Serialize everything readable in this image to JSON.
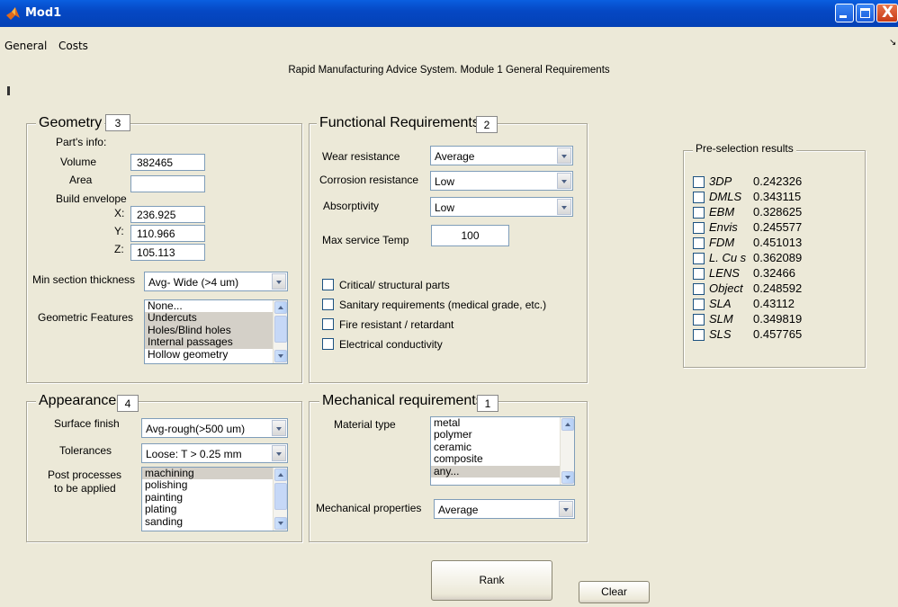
{
  "window": {
    "title": "Mod1",
    "close_label": "X"
  },
  "menu": [
    "General",
    "Costs"
  ],
  "header": "Rapid Manufacturing Advice System. Module 1 General Requirements",
  "geometry": {
    "title": "Geometry",
    "rank": "3",
    "parts_info": "Part's info:",
    "volume_label": "Volume",
    "volume_value": "382465",
    "area_label": "Area",
    "area_value": "",
    "build_envelope": "Build envelope",
    "x_label": "X:",
    "x_value": "236.925",
    "y_label": "Y:",
    "y_value": "110.966",
    "z_label": "Z:",
    "z_value": "105.113",
    "min_section_label": "Min section thickness",
    "min_section_value": "Avg- Wide (>4 um)",
    "features_label": "Geometric Features",
    "features": [
      "None...",
      "Undercuts",
      "Holes/Blind holes",
      "Internal passages",
      "Hollow geometry"
    ]
  },
  "functional": {
    "title": "Functional Requirements",
    "rank": "2",
    "wear_label": "Wear resistance",
    "wear_value": "Average",
    "corrosion_label": "Corrosion resistance",
    "corrosion_value": "Low",
    "absorptivity_label": "Absorptivity",
    "absorptivity_value": "Low",
    "temp_label": "Max service Temp",
    "temp_value": "100",
    "checks": [
      "Critical/ structural parts",
      "Sanitary requirements (medical grade, etc.)",
      "Fire resistant / retardant",
      "Electrical conductivity"
    ]
  },
  "appearance": {
    "title": "Appearance",
    "rank": "4",
    "surface_label": "Surface finish",
    "surface_value": "Avg-rough(>500 um)",
    "tolerance_label": "Tolerances",
    "tolerance_value": "Loose: T > 0.25 mm",
    "post_label_1": "Post processes",
    "post_label_2": "to be applied",
    "post": [
      "machining",
      "polishing",
      "painting",
      "plating",
      "sanding"
    ]
  },
  "mechanical": {
    "title": "Mechanical requirements",
    "rank": "1",
    "material_label": "Material type",
    "materials": [
      "metal",
      "polymer",
      "ceramic",
      "composite",
      "any..."
    ],
    "props_label": "Mechanical properties",
    "props_value": "Average"
  },
  "preselection": {
    "title": "Pre-selection results",
    "results": [
      {
        "name": "3DP",
        "value": "0.242326"
      },
      {
        "name": "DMLS",
        "value": "0.343115"
      },
      {
        "name": "EBM",
        "value": "0.328625"
      },
      {
        "name": "Envis",
        "value": "0.245577"
      },
      {
        "name": "FDM",
        "value": "0.451013"
      },
      {
        "name": "L. Cu s",
        "value": "0.362089"
      },
      {
        "name": "LENS",
        "value": "0.32466"
      },
      {
        "name": "Object",
        "value": "0.248592"
      },
      {
        "name": "SLA",
        "value": "0.43112"
      },
      {
        "name": "SLM",
        "value": "0.349819"
      },
      {
        "name": "SLS",
        "value": "0.457765"
      }
    ]
  },
  "buttons": {
    "rank": "Rank",
    "clear": "Clear"
  }
}
